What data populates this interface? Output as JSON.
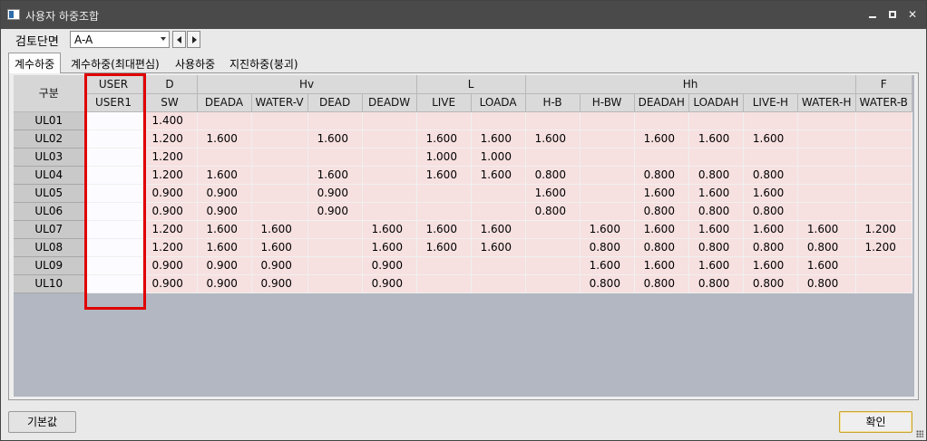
{
  "window": {
    "title": "사용자 하중조합",
    "minimize_icon": "minimize-icon",
    "maximize_icon": "maximize-icon",
    "close_icon": "close-icon"
  },
  "toolbar": {
    "section_label": "검토단면",
    "section_value": "A-A",
    "prev_icon": "triangle-left-icon",
    "next_icon": "triangle-right-icon"
  },
  "tabs": [
    {
      "label": "계수하중",
      "active": true
    },
    {
      "label": "계수하중(최대편심)",
      "active": false
    },
    {
      "label": "사용하중",
      "active": false
    },
    {
      "label": "지진하중(붕괴)",
      "active": false
    }
  ],
  "grid": {
    "corner_label": "구분",
    "groups": [
      {
        "label": "USER",
        "span": 1
      },
      {
        "label": "D",
        "span": 1
      },
      {
        "label": "Hv",
        "span": 4
      },
      {
        "label": "L",
        "span": 2
      },
      {
        "label": "Hh",
        "span": 6
      },
      {
        "label": "F",
        "span": 1
      }
    ],
    "columns": [
      "USER1",
      "SW",
      "DEADA",
      "WATER-V",
      "DEAD",
      "DEADW",
      "LIVE",
      "LOADA",
      "H-B",
      "H-BW",
      "DEADAH",
      "LOADAH",
      "LIVE-H",
      "WATER-H",
      "WATER-B"
    ],
    "rows": [
      {
        "label": "UL01",
        "values": [
          "",
          "1.400",
          "",
          "",
          "",
          "",
          "",
          "",
          "",
          "",
          "",
          "",
          "",
          "",
          ""
        ]
      },
      {
        "label": "UL02",
        "values": [
          "",
          "1.200",
          "1.600",
          "",
          "1.600",
          "",
          "1.600",
          "1.600",
          "1.600",
          "",
          "1.600",
          "1.600",
          "1.600",
          "",
          ""
        ]
      },
      {
        "label": "UL03",
        "values": [
          "",
          "1.200",
          "",
          "",
          "",
          "",
          "1.000",
          "1.000",
          "",
          "",
          "",
          "",
          "",
          "",
          ""
        ]
      },
      {
        "label": "UL04",
        "values": [
          "",
          "1.200",
          "1.600",
          "",
          "1.600",
          "",
          "1.600",
          "1.600",
          "0.800",
          "",
          "0.800",
          "0.800",
          "0.800",
          "",
          ""
        ]
      },
      {
        "label": "UL05",
        "values": [
          "",
          "0.900",
          "0.900",
          "",
          "0.900",
          "",
          "",
          "",
          "1.600",
          "",
          "1.600",
          "1.600",
          "1.600",
          "",
          ""
        ]
      },
      {
        "label": "UL06",
        "values": [
          "",
          "0.900",
          "0.900",
          "",
          "0.900",
          "",
          "",
          "",
          "0.800",
          "",
          "0.800",
          "0.800",
          "0.800",
          "",
          ""
        ]
      },
      {
        "label": "UL07",
        "values": [
          "",
          "1.200",
          "1.600",
          "1.600",
          "",
          "1.600",
          "1.600",
          "1.600",
          "",
          "1.600",
          "1.600",
          "1.600",
          "1.600",
          "1.600",
          "1.200"
        ]
      },
      {
        "label": "UL08",
        "values": [
          "",
          "1.200",
          "1.600",
          "1.600",
          "",
          "1.600",
          "1.600",
          "1.600",
          "",
          "0.800",
          "0.800",
          "0.800",
          "0.800",
          "0.800",
          "1.200"
        ]
      },
      {
        "label": "UL09",
        "values": [
          "",
          "0.900",
          "0.900",
          "0.900",
          "",
          "0.900",
          "",
          "",
          "",
          "1.600",
          "1.600",
          "1.600",
          "1.600",
          "1.600",
          ""
        ]
      },
      {
        "label": "UL10",
        "values": [
          "",
          "0.900",
          "0.900",
          "0.900",
          "",
          "0.900",
          "",
          "",
          "",
          "0.800",
          "0.800",
          "0.800",
          "0.800",
          "0.800",
          ""
        ]
      }
    ]
  },
  "footer": {
    "default_label": "기본값",
    "confirm_label": "확인"
  },
  "colors": {
    "highlight": "#e00000",
    "cell_fill": "#f7e0e0",
    "user_cell_fill": "#fcfbff",
    "titlebar": "#4a4a4a"
  }
}
